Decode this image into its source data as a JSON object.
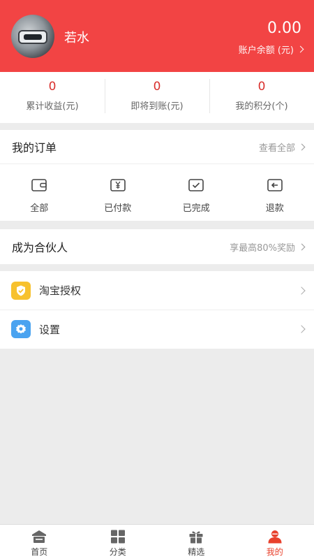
{
  "header": {
    "username": "若水",
    "balance": "0.00",
    "balance_label": "账户余额 (元)",
    "bg_color": "#f24444"
  },
  "stats": [
    {
      "value": "0",
      "label": "累计收益(元)"
    },
    {
      "value": "0",
      "label": "即将到账(元)"
    },
    {
      "value": "0",
      "label": "我的积分(个)"
    }
  ],
  "orders": {
    "title": "我的订单",
    "more": "查看全部",
    "items": [
      {
        "label": "全部",
        "icon": "wallet-icon"
      },
      {
        "label": "已付款",
        "icon": "paid-icon"
      },
      {
        "label": "已完成",
        "icon": "completed-icon"
      },
      {
        "label": "退款",
        "icon": "refund-icon"
      }
    ]
  },
  "partner": {
    "title": "成为合伙人",
    "reward": "享最高80%奖励"
  },
  "menu": [
    {
      "label": "淘宝授权",
      "icon": "shield-check-icon"
    },
    {
      "label": "设置",
      "icon": "gear-icon"
    }
  ],
  "tabbar": [
    {
      "label": "首页",
      "icon": "home-icon"
    },
    {
      "label": "分类",
      "icon": "grid-icon"
    },
    {
      "label": "精选",
      "icon": "gift-icon"
    },
    {
      "label": "我的",
      "icon": "user-icon",
      "active": true
    }
  ],
  "colors": {
    "accent": "#e8412c",
    "stat_value": "#d9302d"
  }
}
